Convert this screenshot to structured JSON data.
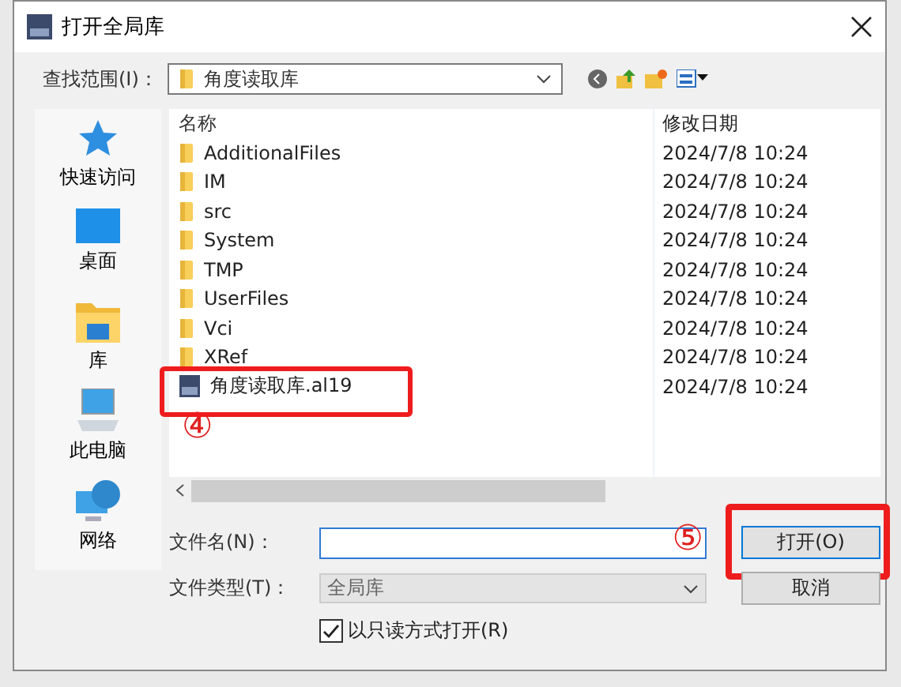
{
  "window": {
    "title": "打开全局库"
  },
  "toolbar": {
    "look_in_label": "查找范围(I)：",
    "look_in_value": "角度读取库"
  },
  "sidebar": {
    "items": [
      {
        "label": "快速访问",
        "kind": "star"
      },
      {
        "label": "桌面",
        "kind": "desktop"
      },
      {
        "label": "库",
        "kind": "library"
      },
      {
        "label": "此电脑",
        "kind": "computer"
      },
      {
        "label": "网络",
        "kind": "network"
      }
    ]
  },
  "file_list": {
    "columns": [
      "名称",
      "修改日期"
    ],
    "rows": [
      {
        "name": "AdditionalFiles",
        "date": "2024/7/8 10:24",
        "kind": "folder",
        "highlighted": false
      },
      {
        "name": "IM",
        "date": "2024/7/8 10:24",
        "kind": "folder",
        "highlighted": false
      },
      {
        "name": "src",
        "date": "2024/7/8 10:24",
        "kind": "folder",
        "highlighted": false
      },
      {
        "name": "System",
        "date": "2024/7/8 10:24",
        "kind": "folder",
        "highlighted": false
      },
      {
        "name": "TMP",
        "date": "2024/7/8 10:24",
        "kind": "folder",
        "highlighted": false
      },
      {
        "name": "UserFiles",
        "date": "2024/7/8 10:24",
        "kind": "folder",
        "highlighted": false
      },
      {
        "name": "Vci",
        "date": "2024/7/8 10:24",
        "kind": "folder",
        "highlighted": false
      },
      {
        "name": "XRef",
        "date": "2024/7/8 10:24",
        "kind": "folder",
        "highlighted": false
      },
      {
        "name": "角度读取库.al19",
        "date": "2024/7/8 10:24",
        "kind": "file",
        "highlighted": true
      }
    ]
  },
  "annotations": [
    {
      "text": "④"
    },
    {
      "text": "⑤"
    }
  ],
  "file_name": {
    "label": "文件名(N)："
  },
  "file_type": {
    "label": "文件类型(T)：",
    "value": "全局库"
  },
  "read_only": {
    "label": "以只读方式打开(R)",
    "checked": true
  },
  "buttons": [
    {
      "label": "打开(O)",
      "highlighted": true
    },
    {
      "label": "取消",
      "highlighted": false
    }
  ]
}
